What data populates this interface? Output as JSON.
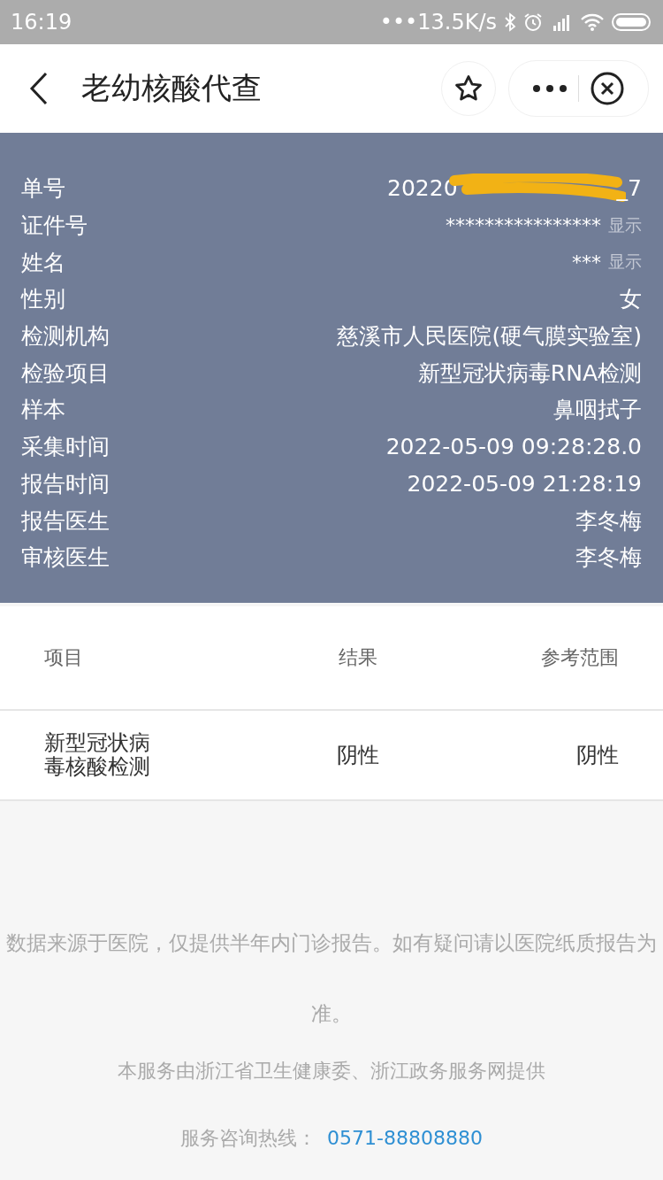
{
  "status_bar": {
    "time": "16:19",
    "network_speed": "•••13.5K/s"
  },
  "header": {
    "title": "老幼核酸代查"
  },
  "info": [
    {
      "kind": "redacted",
      "label": "单号",
      "value_start": "20220",
      "value_end": "_7"
    },
    {
      "kind": "masked",
      "label": "证件号",
      "value": "****************",
      "action": "显示"
    },
    {
      "kind": "masked",
      "label": "姓名",
      "value": "***",
      "action": "显示"
    },
    {
      "kind": "plain",
      "label": "性别",
      "value": "女"
    },
    {
      "kind": "plain",
      "label": "检测机构",
      "value": "慈溪市人民医院(硬气膜实验室)"
    },
    {
      "kind": "plain",
      "label": "检验项目",
      "value": "新型冠状病毒RNA检测"
    },
    {
      "kind": "plain",
      "label": "样本",
      "value": "鼻咽拭子"
    },
    {
      "kind": "plain",
      "label": "采集时间",
      "value": "2022-05-09 09:28:28.0"
    },
    {
      "kind": "plain",
      "label": "报告时间",
      "value": "2022-05-09 21:28:19"
    },
    {
      "kind": "plain",
      "label": "报告医生",
      "value": "李冬梅"
    },
    {
      "kind": "plain",
      "label": "审核医生",
      "value": "李冬梅"
    }
  ],
  "table": {
    "columns": [
      "项目",
      "结果",
      "参考范围"
    ],
    "rows": [
      {
        "item": "新型冠状病毒核酸检测",
        "result": "阴性",
        "reference": "阴性"
      }
    ]
  },
  "footer": {
    "notice": "数据来源于医院，仅提供半年内门诊报告。如有疑问请以医院纸质报告为准。",
    "provider": "本服务由浙江省卫生健康委、浙江政务服务网提供",
    "hotline_label": "服务咨询热线：",
    "hotline": "0571-88808880"
  }
}
